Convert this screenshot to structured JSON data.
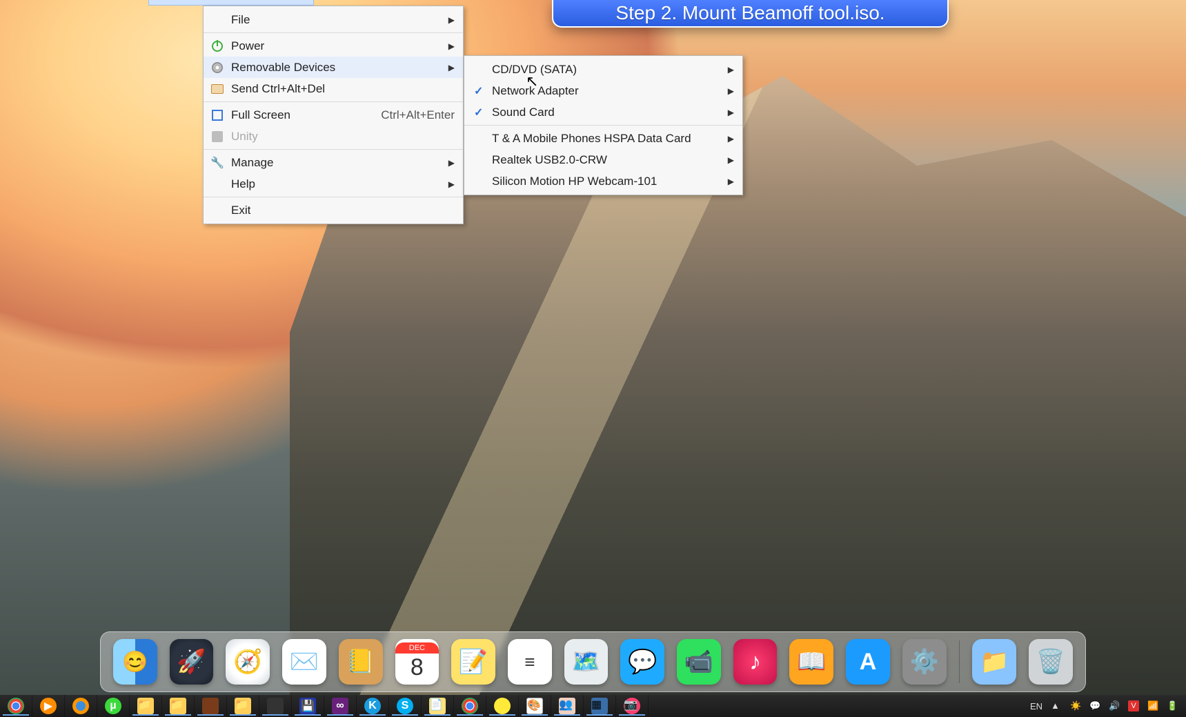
{
  "tooltip": {
    "text": "Step 2. Mount Beamoff tool.iso."
  },
  "menu_main": {
    "file": "File",
    "power": "Power",
    "removable": "Removable Devices",
    "send": "Send Ctrl+Alt+Del",
    "fullscreen": "Full Screen",
    "fullscreen_shortcut": "Ctrl+Alt+Enter",
    "unity": "Unity",
    "manage": "Manage",
    "help": "Help",
    "exit": "Exit"
  },
  "menu_devices": {
    "cddvd": "CD/DVD (SATA)",
    "netadapter": "Network Adapter",
    "soundcard": "Sound Card",
    "hspa": "T & A Mobile Phones HSPA Data Card",
    "realtek": "Realtek USB2.0-CRW",
    "webcam": "Silicon Motion HP Webcam-101"
  },
  "dock": {
    "finder": "Finder",
    "launchpad": "Launchpad",
    "safari": "Safari",
    "mail": "Mail",
    "contacts": "Contacts",
    "calendar": "Calendar",
    "calendar_month": "DEC",
    "calendar_day": "8",
    "notes": "Notes",
    "reminders": "Reminders",
    "maps": "Maps",
    "messages": "Messages",
    "facetime": "FaceTime",
    "itunes": "iTunes",
    "ibooks": "iBooks",
    "appstore": "App Store",
    "prefs": "System Preferences",
    "downloads": "Downloads",
    "trash": "Trash"
  },
  "taskbar": {
    "lang": "EN",
    "items": [
      "chrome",
      "media-player",
      "firefox",
      "utorrent",
      "explorer-1",
      "explorer-2",
      "game",
      "explorer-3",
      "vlc",
      "floppy",
      "visual-studio",
      "kmplayer",
      "skype",
      "document",
      "chrome-2",
      "sticky",
      "paint",
      "users",
      "snip",
      "camera"
    ]
  }
}
